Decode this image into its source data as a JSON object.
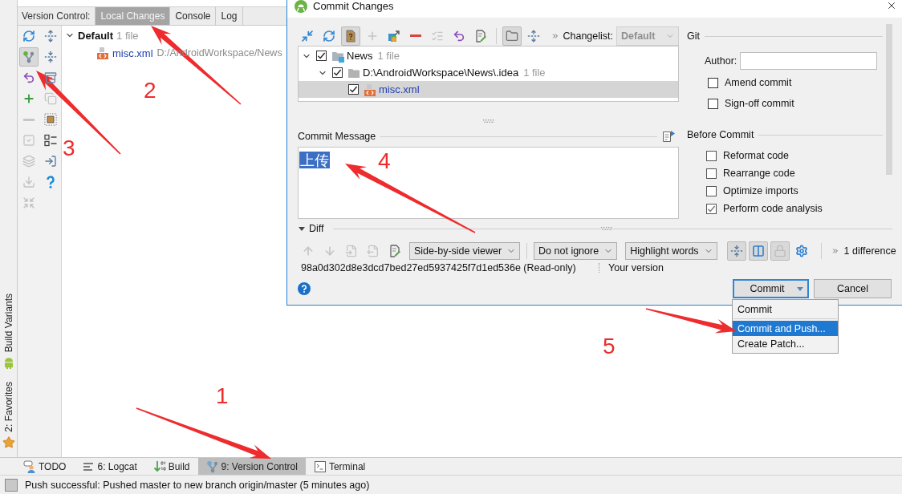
{
  "left_stripe": {
    "tabs": [
      {
        "label": "Build Variants"
      },
      {
        "label": "2: Favorites"
      }
    ]
  },
  "version_control": {
    "title": "Version Control:",
    "tabs": [
      {
        "label": "Local Changes",
        "selected": true
      },
      {
        "label": "Console",
        "selected": false
      },
      {
        "label": "Log",
        "selected": false
      }
    ],
    "toolbar": [
      {
        "selected": false,
        "disabled": false
      },
      {
        "selected": false,
        "disabled": false
      },
      {
        "selected": true,
        "disabled": false
      },
      {
        "selected": false,
        "disabled": false
      },
      {
        "selected": false,
        "disabled": false
      },
      {
        "selected": false,
        "disabled": false
      },
      {
        "selected": false,
        "disabled": false
      },
      {
        "selected": false,
        "disabled": true
      },
      {
        "selected": false,
        "disabled": true
      },
      {
        "selected": false,
        "disabled": false
      },
      {
        "selected": false,
        "disabled": true
      },
      {
        "selected": false,
        "disabled": false
      },
      {
        "selected": false,
        "disabled": true
      },
      {
        "selected": false,
        "disabled": false
      },
      {
        "selected": false,
        "disabled": true
      },
      {
        "selected": false,
        "disabled": false
      },
      {
        "selected": false,
        "disabled": true
      }
    ],
    "tree": [
      {
        "kind": "changelist",
        "name": "Default",
        "count": "1 file",
        "expanded": true,
        "children": [
          {
            "kind": "file",
            "name": "misc.xml",
            "path": "D:/AndroidWorkspace/News"
          }
        ]
      }
    ]
  },
  "dialog": {
    "title": "Commit Changes",
    "toolbar": [
      [
        {
          "selected": false,
          "disabled": false
        },
        {
          "selected": false,
          "disabled": false
        },
        {
          "selected": true,
          "disabled": false
        },
        {
          "selected": false,
          "disabled": true
        },
        {
          "selected": false,
          "disabled": false
        },
        {
          "selected": false,
          "disabled": false
        },
        {
          "selected": false,
          "disabled": true
        },
        {
          "selected": false,
          "disabled": false
        },
        {
          "selected": false,
          "disabled": false
        }
      ],
      [
        {
          "selected": true,
          "disabled": false
        },
        {
          "selected": false,
          "disabled": false
        }
      ]
    ],
    "changelist": {
      "label": "Changelist:",
      "value": "Default",
      "disabled": true
    },
    "tree": [
      {
        "kind": "module",
        "name": "News",
        "count": "1 file",
        "checked": true,
        "expanded": true,
        "selected": false,
        "children": [
          {
            "kind": "folder",
            "name": "D:\\AndroidWorkspace\\News\\.idea",
            "count": "1 file",
            "checked": true,
            "expanded": true,
            "selected": false,
            "children": [
              {
                "kind": "file",
                "name": "misc.xml",
                "checked": true,
                "selected": true
              }
            ]
          }
        ]
      }
    ],
    "commit_message": {
      "label": "Commit Message",
      "value": "上传",
      "text_selected": true
    },
    "git": {
      "title": "Git",
      "author": {
        "label": "Author:"
      },
      "options": [
        {
          "label": "Amend commit",
          "checked": false
        },
        {
          "label": "Sign-off commit",
          "checked": false
        }
      ]
    },
    "before_commit": {
      "title": "Before Commit",
      "options": [
        {
          "label": "Reformat code",
          "checked": false
        },
        {
          "label": "Rearrange code",
          "checked": false
        },
        {
          "label": "Optimize imports",
          "checked": false
        },
        {
          "label": "Perform code analysis",
          "checked": true
        }
      ]
    },
    "diff": {
      "title": "Diff",
      "expanded": true,
      "toolbar": [
        {
          "disabled": true
        },
        {
          "disabled": true
        },
        {
          "disabled": true
        },
        {
          "disabled": true
        },
        {
          "disabled": false
        }
      ],
      "dropdowns": [
        "Side-by-side viewer",
        "Do not ignore",
        "Highlight words"
      ],
      "toggles": [
        {
          "selected": true,
          "disabled": false
        },
        {
          "selected": true,
          "disabled": false
        },
        {
          "selected": true,
          "disabled": true
        },
        {
          "selected": false,
          "disabled": false
        }
      ],
      "differences": "1 difference",
      "left_title": "98a0d302d8e3dcd7bed27ed5937425f7d1ed536e (Read-only)",
      "right_title": "Your version"
    },
    "buttons": [
      {
        "label": "Commit",
        "kind": "split",
        "focused": true
      },
      {
        "label": "Cancel",
        "kind": "plain",
        "focused": false
      }
    ],
    "menu": {
      "groups": [
        [
          {
            "label": "Commit",
            "selected": false
          }
        ],
        [
          {
            "label": "Commit and Push...",
            "selected": true
          },
          {
            "label": "Create Patch...",
            "selected": false
          }
        ]
      ]
    }
  },
  "bottom_bar": {
    "tabs": [
      {
        "label": "TODO",
        "selected": false
      },
      {
        "label": "6: Logcat",
        "selected": false
      },
      {
        "label": "Build",
        "selected": false
      },
      {
        "label": "9: Version Control",
        "selected": true
      },
      {
        "label": "Terminal",
        "selected": false
      }
    ]
  },
  "status_bar": {
    "message": "Push successful: Pushed master to new branch origin/master (5 minutes ago)"
  },
  "annotations": [
    {
      "label": "1"
    },
    {
      "label": "2"
    },
    {
      "label": "3"
    },
    {
      "label": "4"
    },
    {
      "label": "5"
    }
  ]
}
